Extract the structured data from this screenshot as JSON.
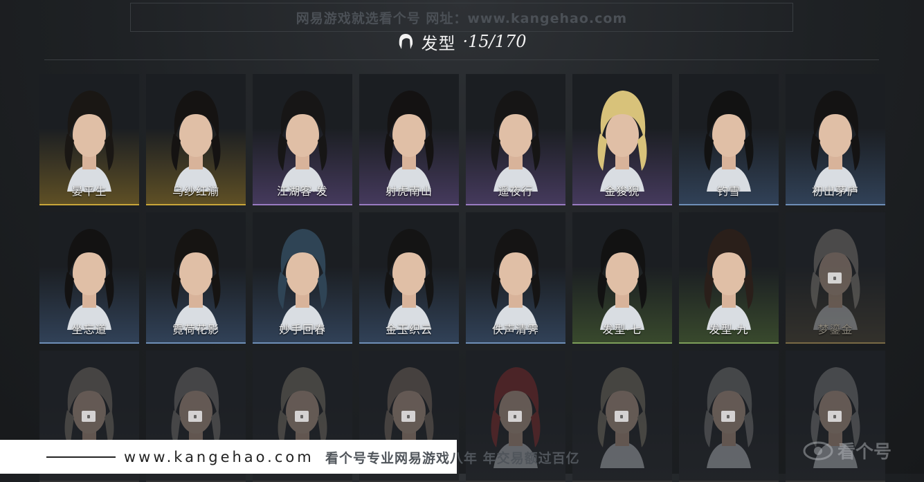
{
  "banner": {
    "text": "网易游戏就选看个号  网址：www.kangehao.com"
  },
  "header": {
    "title": "发型",
    "count": "·15/170",
    "icon": "hair-icon"
  },
  "hairstyles": [
    {
      "name": "晏平生",
      "locked": false,
      "accent": "#c9a63a",
      "glow": "rgba(150,120,40,0.55)",
      "hair": "#1a1714"
    },
    {
      "name": "乌纱红湔",
      "locked": false,
      "accent": "#c9a63a",
      "glow": "rgba(150,120,40,0.55)",
      "hair": "#151312"
    },
    {
      "name": "江湖客·发",
      "locked": false,
      "accent": "#9a7cc2",
      "glow": "rgba(110,85,150,0.5)",
      "hair": "#171616"
    },
    {
      "name": "射虎南山",
      "locked": false,
      "accent": "#9a7cc2",
      "glow": "rgba(110,85,150,0.5)",
      "hair": "#141212"
    },
    {
      "name": "遥夜行",
      "locked": false,
      "accent": "#9a7cc2",
      "glow": "rgba(110,85,150,0.5)",
      "hair": "#161515"
    },
    {
      "name": "金狻猊",
      "locked": false,
      "accent": "#9a7cc2",
      "glow": "rgba(110,85,150,0.5)",
      "hair": "#d8c27a"
    },
    {
      "name": "钓雪",
      "locked": false,
      "accent": "#6f8fb8",
      "glow": "rgba(70,100,140,0.5)",
      "hair": "#121212"
    },
    {
      "name": "初出茅庐",
      "locked": false,
      "accent": "#6f8fb8",
      "glow": "rgba(70,100,140,0.5)",
      "hair": "#141313"
    },
    {
      "name": "坐忘道",
      "locked": false,
      "accent": "#6f8fb8",
      "glow": "rgba(70,100,140,0.5)",
      "hair": "#131212"
    },
    {
      "name": "霓荷花影",
      "locked": false,
      "accent": "#6f8fb8",
      "glow": "rgba(70,100,140,0.5)",
      "hair": "#161412"
    },
    {
      "name": "妙手回春",
      "locked": false,
      "accent": "#6f8fb8",
      "glow": "rgba(70,100,140,0.5)",
      "hair": "#2f4455"
    },
    {
      "name": "金玉织云",
      "locked": false,
      "accent": "#6f8fb8",
      "glow": "rgba(70,100,140,0.5)",
      "hair": "#141414"
    },
    {
      "name": "佚声清霁",
      "locked": false,
      "accent": "#6f8fb8",
      "glow": "rgba(70,100,140,0.5)",
      "hair": "#151414"
    },
    {
      "name": "发型·七",
      "locked": false,
      "accent": "#7fa05a",
      "glow": "rgba(85,115,55,0.5)",
      "hair": "#121212"
    },
    {
      "name": "发型·九",
      "locked": false,
      "accent": "#7fa05a",
      "glow": "rgba(85,115,55,0.5)",
      "hair": "#2a1f1a"
    },
    {
      "name": "梦鎏金",
      "locked": true,
      "accent": "#7a6a45",
      "glow": "rgba(110,95,60,0.4)",
      "hair": "#9b958b"
    },
    {
      "name": "",
      "locked": true,
      "accent": "#333",
      "glow": "rgba(60,60,60,0.2)",
      "hair": "#8d8377"
    },
    {
      "name": "",
      "locked": true,
      "accent": "#333",
      "glow": "rgba(60,60,60,0.2)",
      "hair": "#8b8781"
    },
    {
      "name": "",
      "locked": true,
      "accent": "#333",
      "glow": "rgba(60,60,60,0.2)",
      "hair": "#8e8474"
    },
    {
      "name": "",
      "locked": true,
      "accent": "#333",
      "glow": "rgba(60,60,60,0.2)",
      "hair": "#8d7c6e"
    },
    {
      "name": "",
      "locked": true,
      "accent": "#333",
      "glow": "rgba(60,60,60,0.2)",
      "hair": "#9b2a2a"
    },
    {
      "name": "",
      "locked": true,
      "accent": "#333",
      "glow": "rgba(60,60,60,0.2)",
      "hair": "#8e8673"
    },
    {
      "name": "",
      "locked": true,
      "accent": "#333",
      "glow": "rgba(60,60,60,0.2)",
      "hair": "#8a8a88"
    },
    {
      "name": "",
      "locked": true,
      "accent": "#333",
      "glow": "rgba(60,60,60,0.2)",
      "hair": "#909090"
    }
  ],
  "footer": {
    "url": "www.kangehao.com",
    "slogan": "看个号专业网易游戏八年  年交易额过百亿",
    "logo": "看个号"
  }
}
